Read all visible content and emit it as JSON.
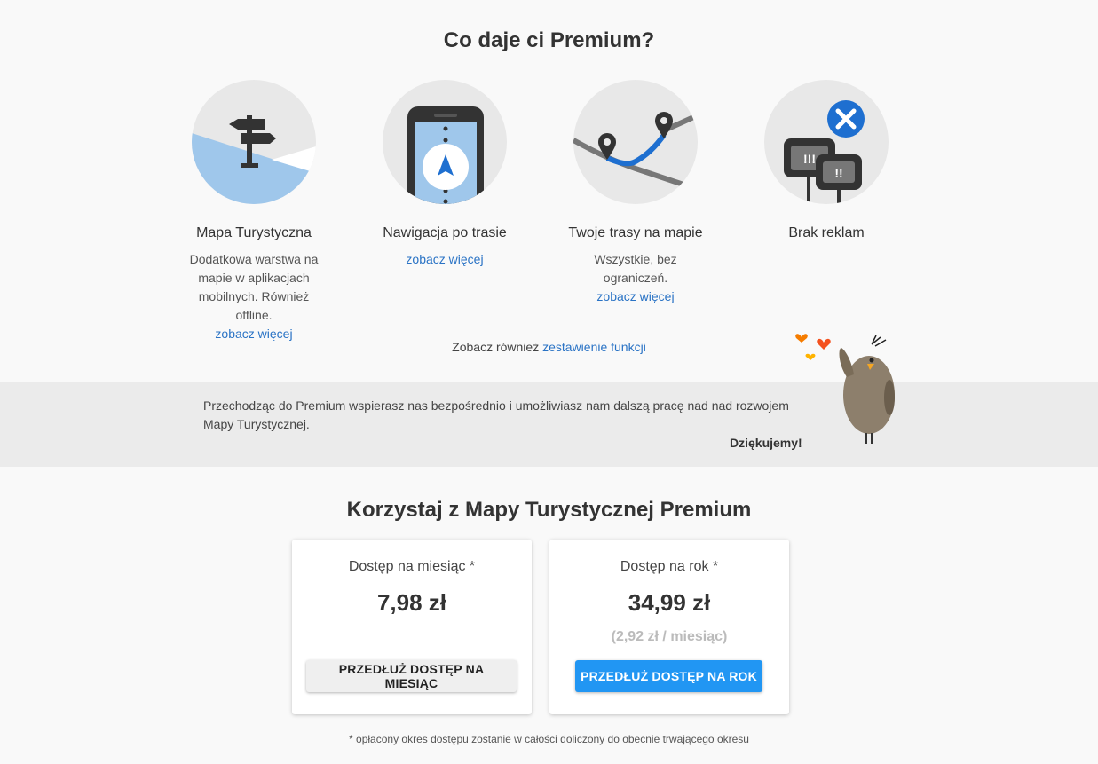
{
  "title": "Co daje ci Premium?",
  "features": [
    {
      "name": "Mapa Turystyczna",
      "desc": "Dodatkowa warstwa na mapie w aplikacjach mobilnych. Również offline.",
      "link": "zobacz więcej",
      "icon": "signpost-icon"
    },
    {
      "name": "Nawigacja po trasie",
      "desc": "",
      "link": "zobacz więcej",
      "icon": "phone-navigation-icon"
    },
    {
      "name": "Twoje trasy na mapie",
      "desc": "Wszystkie, bez ograniczeń.",
      "link": "zobacz więcej",
      "icon": "map-route-icon"
    },
    {
      "name": "Brak reklam",
      "desc": "",
      "link": "",
      "icon": "no-ads-icon"
    }
  ],
  "see_also": {
    "prefix": "Zobacz również",
    "link": "zestawienie funkcji"
  },
  "support": {
    "message": "Przechodząc do Premium wspierasz nas bezpośrednio i umożliwiasz nam dalszą pracę nad nad rozwojem Mapy Turystycznej.",
    "thanks": "Dziękujemy!"
  },
  "pricing_title": "Korzystaj z Mapy Turystycznej Premium",
  "plans": [
    {
      "label": "Dostęp na miesiąc *",
      "price": "7,98 zł",
      "per_month": "",
      "button": "PRZEDŁUŻ DOSTĘP NA MIESIĄC"
    },
    {
      "label": "Dostęp na rok *",
      "price": "34,99 zł",
      "per_month": "(2,92 zł / miesiąc)",
      "button": "PRZEDŁUŻ DOSTĘP NA ROK"
    }
  ],
  "footnote": "* opłacony okres dostępu zostanie w całości doliczony do obecnie trwającego okresu",
  "colors": {
    "link": "#2a73c5",
    "primary_button": "#2196f3",
    "band": "#ebebeb"
  }
}
